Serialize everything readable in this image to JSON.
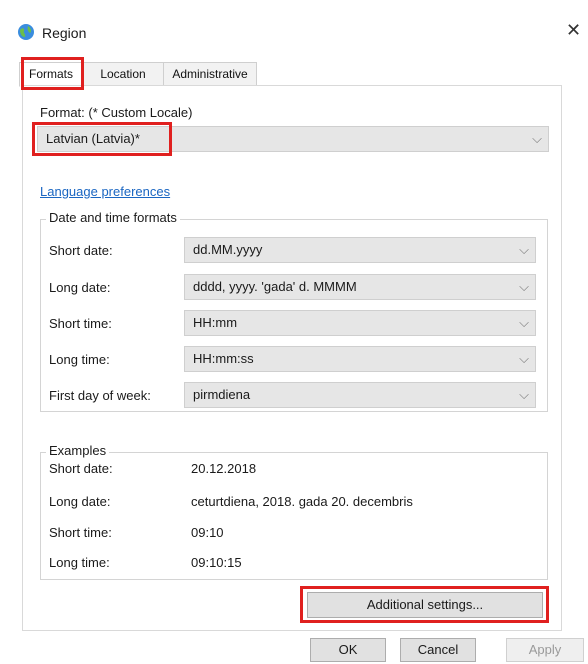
{
  "window": {
    "title": "Region",
    "close_glyph": "✕",
    "icon": "globe-icon"
  },
  "tabs": [
    {
      "label": "Formats",
      "active": true
    },
    {
      "label": "Location",
      "active": false
    },
    {
      "label": "Administrative",
      "active": false
    }
  ],
  "format": {
    "label": "Format: (* Custom Locale)",
    "value": "Latvian (Latvia)*"
  },
  "language_link": "Language preferences",
  "date_time": {
    "group_label": "Date and time formats",
    "rows": [
      {
        "label": "Short date:",
        "value": "dd.MM.yyyy"
      },
      {
        "label": "Long date:",
        "value": "dddd, yyyy. 'gada' d. MMMM"
      },
      {
        "label": "Short time:",
        "value": "HH:mm"
      },
      {
        "label": "Long time:",
        "value": "HH:mm:ss"
      },
      {
        "label": "First day of week:",
        "value": "pirmdiena"
      }
    ]
  },
  "examples": {
    "group_label": "Examples",
    "rows": [
      {
        "label": "Short date:",
        "value": "20.12.2018"
      },
      {
        "label": "Long date:",
        "value": "ceturtdiena, 2018. gada 20. decembris"
      },
      {
        "label": "Short time:",
        "value": "09:10"
      },
      {
        "label": "Long time:",
        "value": "09:10:15"
      }
    ]
  },
  "buttons": {
    "additional": "Additional settings...",
    "ok": "OK",
    "cancel": "Cancel",
    "apply": "Apply"
  },
  "chevron_glyph": "⌵",
  "colors": {
    "highlight": "#e0201f",
    "link": "#1a66c2"
  }
}
